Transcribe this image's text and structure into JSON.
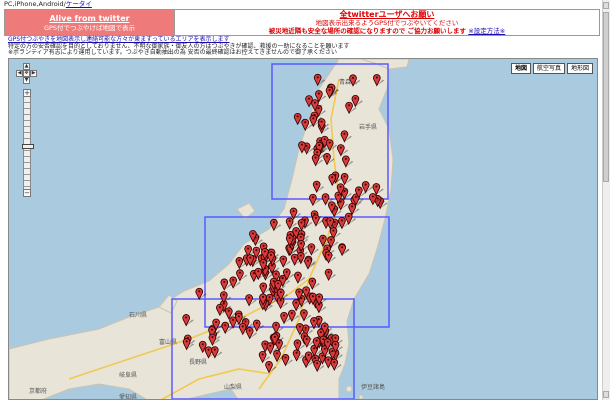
{
  "topnav": {
    "text": "PC,iPhone,Android/",
    "link": "ケータイ"
  },
  "header": {
    "alive_title": "Alive from twitter",
    "alive_sub": "GPS付でつぶやけば地図で表示",
    "notice_1": "全twitterユーザへお願い",
    "notice_2": "地図表示出来るようGPS付でつぶやいてください",
    "notice_3": "被災地近隣も安全な場所の確認になりますので ご協力お願いします",
    "notice_link": "※設定方法※"
  },
  "info": {
    "line1": "GPS付つぶやきを地図表示し連絡可能な方々が東ますっているエリアを表示します",
    "line2": "特定の方の安否確認を目的としておりません、不明な御家族・御友人の方はつぶやきが確認、救援の一助になることを願います",
    "line3": "※ボランティア有志により運用しています。つぶやき自動抽出の為 安否の最終確認はお控えてきませんので御了承ください"
  },
  "map": {
    "type_buttons": [
      "地図",
      "航空写真",
      "地形図"
    ],
    "active_type": "地図",
    "pan": {
      "up": "▲",
      "down": "▼",
      "left": "◀",
      "right": "▶",
      "center": "✥"
    },
    "zoom_in": "+",
    "zoom_out": "−",
    "zoom_level_fraction": 0.55,
    "labels": [
      "石川県",
      "富山県",
      "長野県",
      "山梨県",
      "岐阜県",
      "愛知県",
      "京都府",
      "伊豆諸島",
      "青森県",
      "岩手県"
    ],
    "colors": {
      "sea": "#aacbdf",
      "land": "#e8e4d8",
      "coast": "#c9c3b2",
      "road": "#f2c94c",
      "box": "#5a5aff",
      "pin": "#d93a3a"
    }
  }
}
